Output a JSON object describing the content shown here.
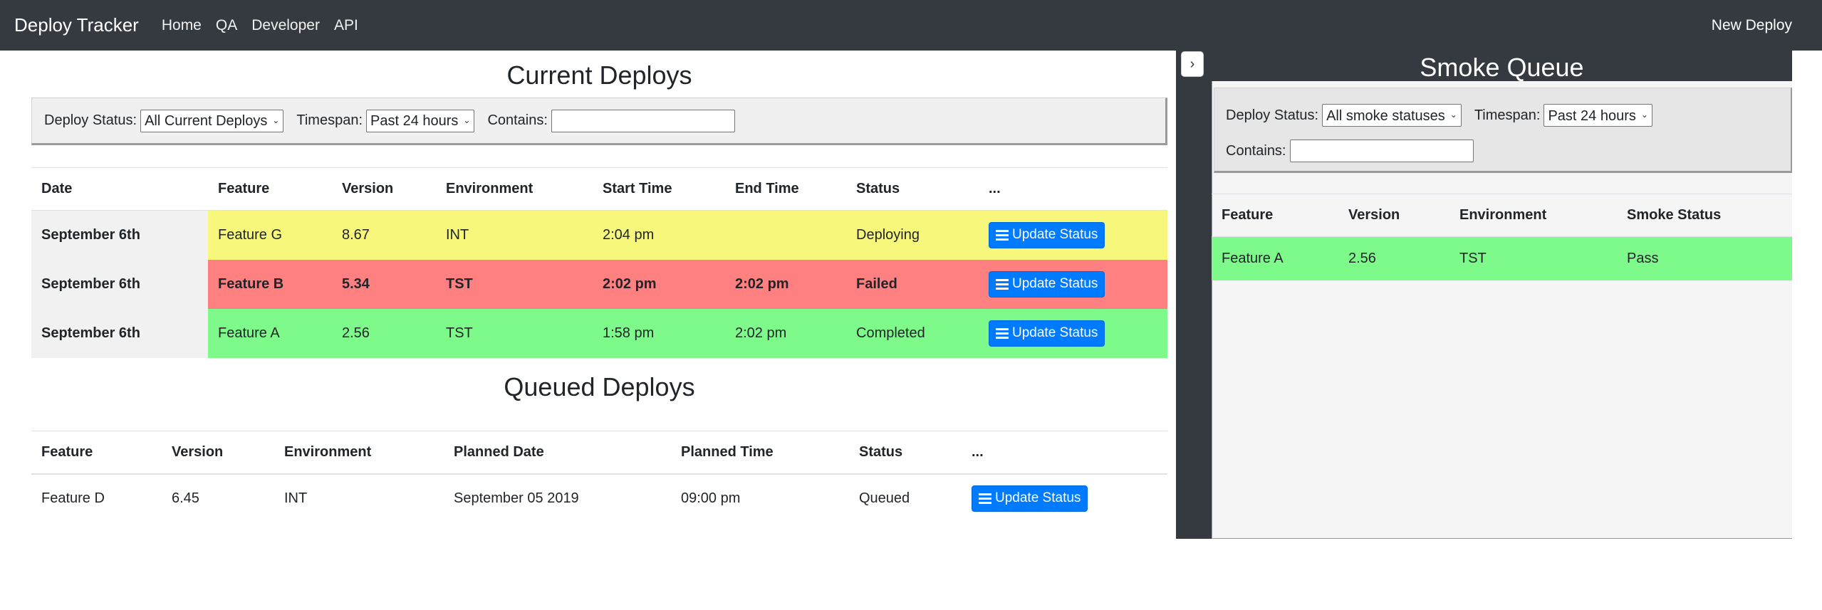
{
  "navbar": {
    "brand": "Deploy Tracker",
    "links": [
      "Home",
      "QA",
      "Developer",
      "API"
    ],
    "right_link": "New Deploy"
  },
  "current": {
    "title": "Current Deploys",
    "filters": {
      "status_label": "Deploy Status:",
      "status_value": "All Current Deploys",
      "timespan_label": "Timespan:",
      "timespan_value": "Past 24 hours",
      "contains_label": "Contains:",
      "contains_value": ""
    },
    "columns": [
      "Date",
      "Feature",
      "Version",
      "Environment",
      "Start Time",
      "End Time",
      "Status",
      "..."
    ],
    "rows": [
      {
        "date": "September 6th",
        "feature": "Feature G",
        "version": "8.67",
        "environment": "INT",
        "start": "2:04 pm",
        "end": "",
        "status": "Deploying",
        "action": "Update Status"
      },
      {
        "date": "September 6th",
        "feature": "Feature B",
        "version": "5.34",
        "environment": "TST",
        "start": "2:02 pm",
        "end": "2:02 pm",
        "status": "Failed",
        "action": "Update Status"
      },
      {
        "date": "September 6th",
        "feature": "Feature A",
        "version": "2.56",
        "environment": "TST",
        "start": "1:58 pm",
        "end": "2:02 pm",
        "status": "Completed",
        "action": "Update Status"
      }
    ]
  },
  "queued": {
    "title": "Queued Deploys",
    "columns": [
      "Feature",
      "Version",
      "Environment",
      "Planned Date",
      "Planned Time",
      "Status",
      "..."
    ],
    "rows": [
      {
        "feature": "Feature D",
        "version": "6.45",
        "environment": "INT",
        "planned_date": "September 05 2019",
        "planned_time": "09:00 pm",
        "status": "Queued",
        "action": "Update Status"
      }
    ]
  },
  "smoke": {
    "toggle": "›",
    "title": "Smoke Queue",
    "filters": {
      "status_label": "Deploy Status:",
      "status_value": "All smoke statuses",
      "timespan_label": "Timespan:",
      "timespan_value": "Past 24 hours",
      "contains_label": "Contains:",
      "contains_value": ""
    },
    "columns": [
      "Feature",
      "Version",
      "Environment",
      "Smoke Status"
    ],
    "rows": [
      {
        "feature": "Feature A",
        "version": "2.56",
        "environment": "TST",
        "smoke_status": "Pass"
      }
    ]
  },
  "colors": {
    "navbar": "#343a40",
    "deploying": "#f7f77b",
    "failed": "#ff8080",
    "completed": "#7dfa8a",
    "button": "#007bff"
  },
  "icons": {
    "update_button": "list-icon",
    "select_arrow": "chevron-down-icon",
    "panel_toggle": "chevron-right-icon"
  }
}
